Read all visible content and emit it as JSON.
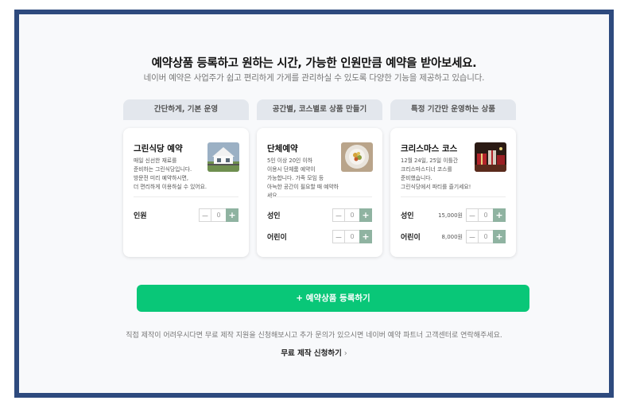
{
  "header": {
    "title": "예약상품 등록하고 원하는 시간, 가능한 인원만큼 예약을 받아보세요.",
    "subtitle": "네이버 예약은 사업주가 쉽고 편리하게 가게를 관리하실 수 있도록 다양한 기능을 제공하고 있습니다."
  },
  "tabs": [
    {
      "label": "간단하게, 기본 운영"
    },
    {
      "label": "공간별, 코스별로 상품 만들기"
    },
    {
      "label": "특정 기간만 운영하는 상품"
    }
  ],
  "cards": [
    {
      "title": "그린식당 예약",
      "desc": "매일 신선한 재료를\n준비하는 그린식당입니다.\n방문전 미리 예약하시면,\n더 편리하게 이용하실 수 있어요.",
      "image": "house-photo",
      "rows": [
        {
          "label": "인원",
          "price": "",
          "value": "0"
        }
      ]
    },
    {
      "title": "단체예약",
      "desc": "5인 이상 20인 이하\n이용시 단체룸 예약이\n가능합니다. 가족 모임 등\n아늑한 공간이 필요할 때 예약하세요.",
      "image": "food-plate-photo",
      "rows": [
        {
          "label": "성인",
          "price": "",
          "value": "0"
        },
        {
          "label": "어린이",
          "price": "",
          "value": "0"
        }
      ]
    },
    {
      "title": "크리스마스 코스",
      "desc": "12월 24일, 25일 이틀간\n크리스마스디너 코스를\n준비했습니다.\n그린식당에서 파티를 즐기세요!",
      "image": "christmas-gifts-photo",
      "rows": [
        {
          "label": "성인",
          "price": "15,000원",
          "value": "0"
        },
        {
          "label": "어린이",
          "price": "8,000원",
          "value": "0"
        }
      ]
    }
  ],
  "stepper": {
    "minus": "−",
    "plus": "+"
  },
  "register_button": "+ 예약상품 등록하기",
  "notice": "직접 제작이 어려우시다면 무료 제작 지원을 신청해보시고 추가 문의가 있으시면 네이버 예약 파트너 고객센터로 연락해주세요.",
  "free_link": {
    "label": "무료 제작 신청하기",
    "chevron": "›"
  },
  "colors": {
    "frame": "#2e4a7e",
    "accent": "#09c778",
    "stepper_plus": "#8fb3a1"
  }
}
